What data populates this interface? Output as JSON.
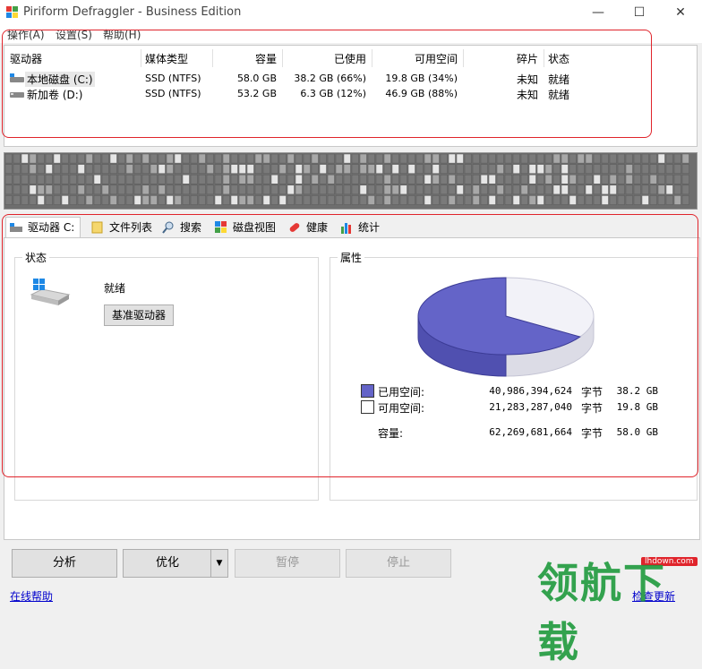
{
  "window": {
    "title": "Piriform Defraggler - Business Edition",
    "minimize": "—",
    "maximize": "☐",
    "close": "✕"
  },
  "menu": [
    "操作(A)",
    "设置(S)",
    "帮助(H)"
  ],
  "drives": {
    "headers": [
      "驱动器",
      "媒体类型",
      "容量",
      "已使用",
      "可用空间",
      "碎片",
      "状态"
    ],
    "rows": [
      {
        "name": "本地磁盘 (C:)",
        "media": "SSD (NTFS)",
        "capacity": "58.0 GB",
        "used": "38.2 GB (66%)",
        "free": "19.8 GB (34%)",
        "frag": "未知",
        "status": "就绪"
      },
      {
        "name": "新加卷 (D:)",
        "media": "SSD (NTFS)",
        "capacity": "53.2 GB",
        "used": "6.3 GB (12%)",
        "free": "46.9 GB (88%)",
        "frag": "未知",
        "status": "就绪"
      }
    ]
  },
  "tabs": [
    "驱动器 C:",
    "文件列表",
    "搜索",
    "磁盘视图",
    "健康",
    "统计"
  ],
  "status_group": {
    "label": "状态",
    "status": "就绪",
    "benchmark": "基准驱动器"
  },
  "props_group": {
    "label": "属性",
    "used": {
      "label": "已用空间:",
      "bytes": "40,986,394,624",
      "unit": "字节",
      "size": "38.2 GB"
    },
    "free": {
      "label": "可用空间:",
      "bytes": "21,283,287,040",
      "unit": "字节",
      "size": "19.8 GB"
    },
    "total": {
      "label": "容量:",
      "bytes": "62,269,681,664",
      "unit": "字节",
      "size": "58.0 GB"
    },
    "used_fraction": 0.66,
    "colors": {
      "used": "#6464c8",
      "free": "#f2f2f8"
    }
  },
  "buttons": {
    "analyze": "分析",
    "optimize": "优化",
    "pause": "暂停",
    "stop": "停止"
  },
  "footer": {
    "help": "在线帮助",
    "update": "检查更新"
  },
  "watermark": {
    "domain": "lhdown.com",
    "text": "领航下载"
  }
}
